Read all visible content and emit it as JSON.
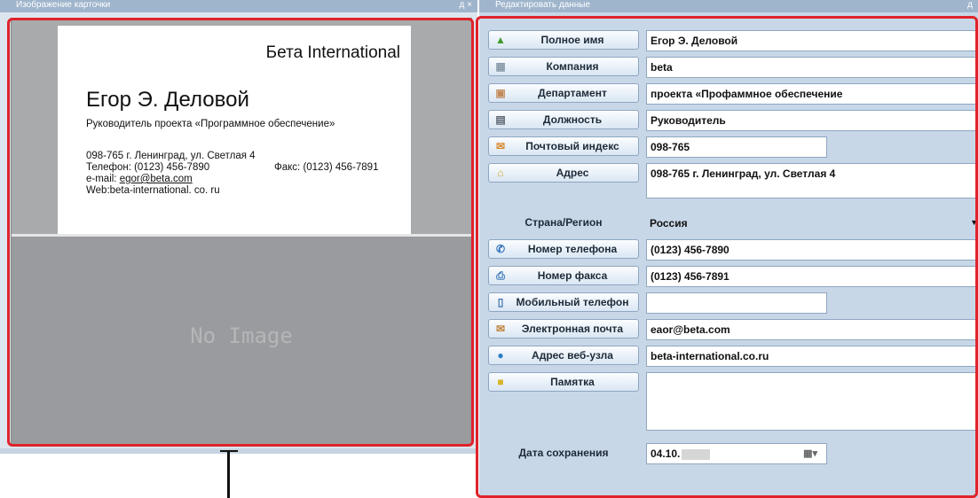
{
  "left_panel": {
    "title": "Изображение карточки",
    "controls": "д ×",
    "card": {
      "company": "Бета International",
      "name": "Егор Э. Деловой",
      "role": "Руководитель проекта «Программное обеспечение»",
      "address": "098-765 г. Ленинград, ул. Светлая 4",
      "phone": "Телефон: (0123) 456-7890",
      "fax": "Факс: (0123) 456-7891",
      "email_prefix": "e-mail: ",
      "email": "egor@beta.com",
      "web": "Web:beta-international. co. ru"
    },
    "no_image_text": "No Image"
  },
  "right_panel": {
    "title": "Редактировать данные",
    "controls": "д",
    "fields": {
      "full_name": {
        "label": "Полное имя",
        "value": "Егор Э. Деловой",
        "icon": "person-icon"
      },
      "company": {
        "label": "Компания",
        "value": "beta",
        "icon": "building-icon"
      },
      "department": {
        "label": "Департамент",
        "value": "проекта «Профаммное обеспечение",
        "icon": "door-icon"
      },
      "position": {
        "label": "Должность",
        "value": "Руководитель",
        "icon": "desk-icon"
      },
      "postal_code": {
        "label": "Почтовый индекс",
        "value": "098-765",
        "icon": "postal-icon"
      },
      "address": {
        "label": "Адрес",
        "value": "098-765 г. Ленинград, ул. Светлая 4",
        "icon": "house-icon"
      },
      "country": {
        "label": "Страна/Регион",
        "value": "Россия"
      },
      "phone": {
        "label": "Номер телефона",
        "value": "(0123) 456-7890",
        "icon": "phone-icon"
      },
      "fax": {
        "label": "Номер факса",
        "value": "(0123) 456-7891",
        "icon": "fax-icon"
      },
      "mobile": {
        "label": "Мобильный телефон",
        "value": "",
        "icon": "mobile-icon"
      },
      "email": {
        "label": "Электронная почта",
        "value": "eaor@beta.com",
        "icon": "envelope-icon"
      },
      "website": {
        "label": "Адрес веб-узла",
        "value": "beta-international.co.ru",
        "icon": "globe-icon"
      },
      "memo": {
        "label": "Памятка",
        "value": "",
        "icon": "note-icon"
      },
      "save_date": {
        "label": "Дата сохранения",
        "value": "04.10."
      }
    }
  },
  "colors": {
    "highlight": "#e0232b",
    "panel_bg": "#c8d7e8",
    "button_border": "#8ea6c0"
  }
}
